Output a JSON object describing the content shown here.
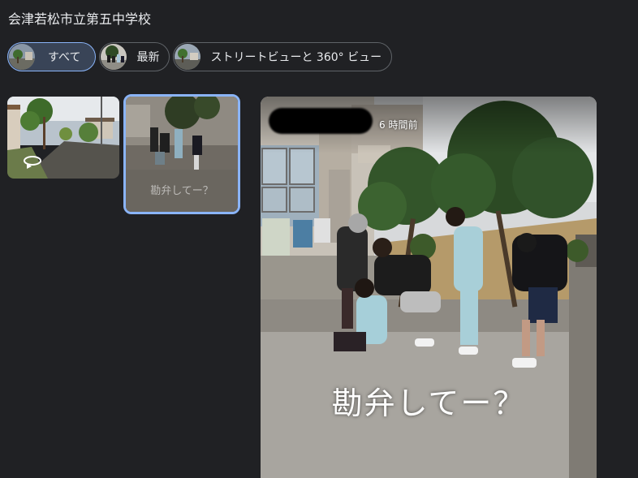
{
  "place_title": "会津若松市立第五中学校",
  "filters": [
    {
      "label": "すべて",
      "active": true
    },
    {
      "label": "最新",
      "active": false
    },
    {
      "label": "ストリートビューと 360° ビュー",
      "active": false
    }
  ],
  "gallery": {
    "tile2_caption": "勘弁してー？"
  },
  "viewer": {
    "time_ago": "6 時間前",
    "caption": "勘弁してー？"
  },
  "colors": {
    "background": "#202124",
    "accent": "#8ab4f8",
    "chip_active": "#394457"
  }
}
